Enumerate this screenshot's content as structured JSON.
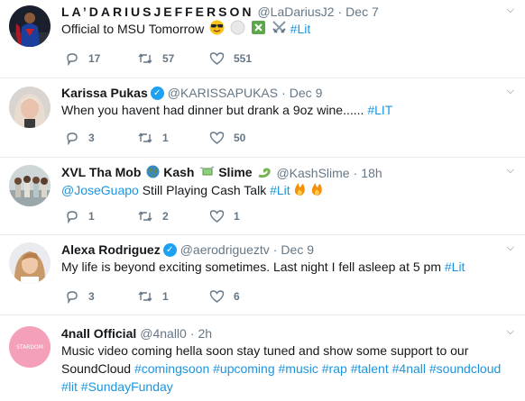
{
  "tweets": [
    {
      "name": "LA’DARIUSJEFFERSON",
      "handle": "@LaDariusJ2",
      "time": "Dec 7",
      "text": "Official to MSU Tomorrow",
      "tag": "#Lit",
      "replies": "17",
      "retweets": "57",
      "likes": "551"
    },
    {
      "name": "Karissa Pukas",
      "handle": "@KARISSAPUKAS",
      "time": "Dec 9",
      "text": "When you havent had dinner but drank a 9oz wine......",
      "tag": "#LIT",
      "replies": "3",
      "retweets": "1",
      "likes": "50"
    },
    {
      "name_part1": "XVL Tha Mob",
      "name_part2": "Kash",
      "name_part3": "Slime",
      "handle": "@KashSlime",
      "time": "18h",
      "mention": "@JoseGuapo",
      "text": "Still Playing Cash Talk",
      "tag": "#Lit",
      "replies": "1",
      "retweets": "2",
      "likes": "1"
    },
    {
      "name": "Alexa Rodriguez",
      "handle": "@aerodrigueztv",
      "time": "Dec 9",
      "text": "My life is beyond exciting sometimes. Last night I fell asleep at 5 pm",
      "tag": "#Lit",
      "replies": "3",
      "retweets": "1",
      "likes": "6"
    },
    {
      "name": "4nall Official",
      "handle": "@4nall0",
      "time": "2h",
      "avatar_text": "STARDOM",
      "text_line1": "Music video coming hella soon stay tuned and show some support to our",
      "text_line2_prefix": "SoundCloud",
      "tags_line2": [
        "#comingsoon",
        "#upcoming",
        "#music",
        "#rap",
        "#talent",
        "#4nall",
        "#soundcloud"
      ],
      "tags_line3": [
        "#lit",
        "#SundayFunday"
      ]
    }
  ],
  "colors": {
    "accent": "#1da1f2",
    "link": "#1b95e0",
    "muted": "#657786",
    "border": "#e6ecf0"
  }
}
